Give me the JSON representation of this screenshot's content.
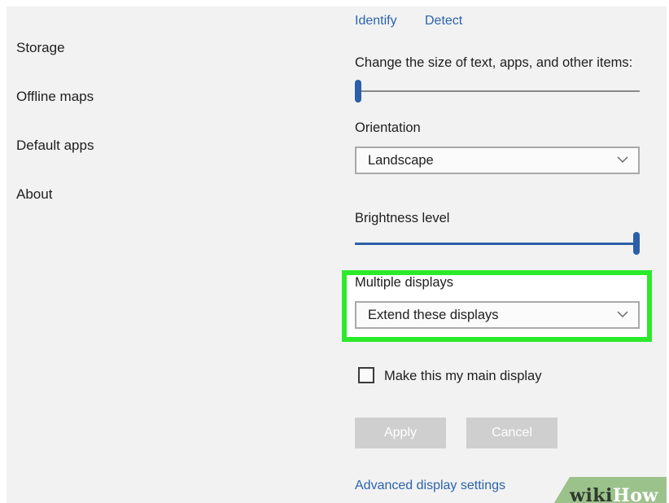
{
  "sidebar": {
    "items": [
      {
        "label": "Storage"
      },
      {
        "label": "Offline maps"
      },
      {
        "label": "Default apps"
      },
      {
        "label": "About"
      }
    ]
  },
  "display": {
    "identify_link": "Identify",
    "detect_link": "Detect",
    "scale_label": "Change the size of text, apps, and other items:",
    "scale_level": 0,
    "orientation_label": "Orientation",
    "orientation_value": "Landscape",
    "brightness_label": "Brightness level",
    "brightness_level": 1.0,
    "multiple_displays_label": "Multiple displays",
    "multiple_displays_value": "Extend these displays",
    "main_display_checkbox_label": "Make this my main display",
    "main_display_checked": false,
    "apply_button": "Apply",
    "cancel_button": "Cancel",
    "advanced_link": "Advanced display settings"
  },
  "watermark": {
    "wiki": "wiki",
    "how": "How"
  },
  "colors": {
    "accent": "#2c5fa8",
    "link": "#2a63ad",
    "highlight": "#2bea2b",
    "panel_bg": "#f2f2f2",
    "disabled_button": "#cfcfcf"
  }
}
